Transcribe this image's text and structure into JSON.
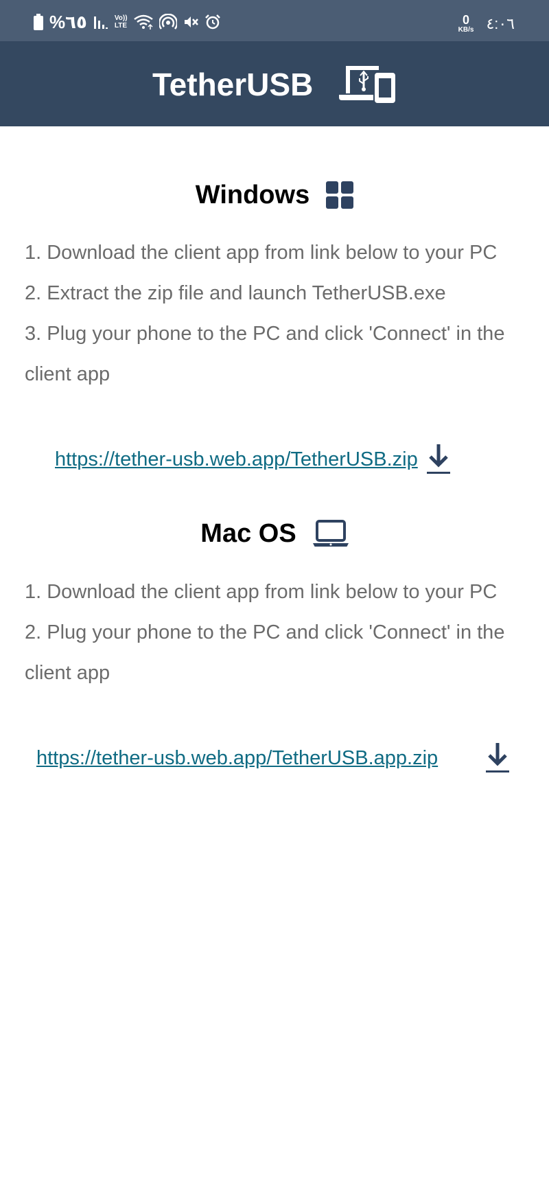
{
  "status_bar": {
    "battery_text": "%٦٥",
    "volte_label": "Vo))",
    "lte_label": "LTE",
    "net_speed_value": "0",
    "net_speed_unit": "KB/s",
    "time": "٤:٠٦"
  },
  "header": {
    "title": "TetherUSB",
    "logo_icon": "laptop-phone-usb-icon"
  },
  "windows": {
    "heading": "Windows",
    "icon": "windows-icon",
    "steps": [
      "1. Download the client app from link below to your PC",
      "2. Extract the zip file and launch TetherUSB.exe",
      "3. Plug your phone to the PC and click 'Connect' in the client app"
    ],
    "download_link": "https://tether-usb.web.app/TetherUSB.zip",
    "download_icon": "download-icon"
  },
  "mac": {
    "heading": "Mac OS",
    "icon": "laptop-icon",
    "steps": [
      "1. Download the client app from link below to your PC",
      "2. Plug your phone to the PC and click 'Connect' in the client app"
    ],
    "download_link": "https://tether-usb.web.app/TetherUSB.app.zip",
    "download_icon": "download-icon"
  },
  "colors": {
    "status_bar_bg": "#4b5d74",
    "header_bg": "#344860",
    "icon_color": "#2e4260",
    "link_color": "#0f6b83",
    "body_text": "#6b6b6b"
  }
}
